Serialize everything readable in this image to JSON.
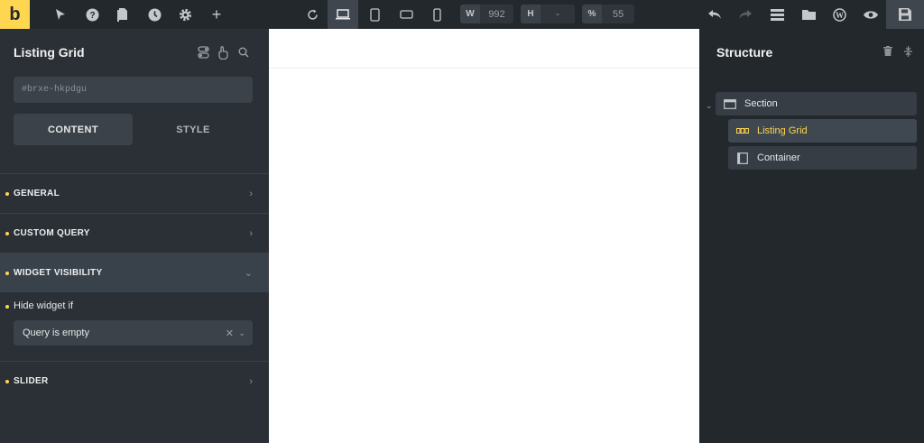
{
  "topbar": {
    "logo": "b",
    "width_label": "W",
    "width_value": "992",
    "height_label": "H",
    "height_value": "-",
    "zoom_label": "%",
    "zoom_value": "55"
  },
  "left_panel": {
    "title": "Listing Grid",
    "id_value": "#brxe-hkpdgu",
    "tabs": [
      {
        "label": "CONTENT",
        "active": true
      },
      {
        "label": "STYLE",
        "active": false
      }
    ],
    "sections": [
      {
        "label": "GENERAL"
      },
      {
        "label": "CUSTOM QUERY"
      },
      {
        "label": "WIDGET VISIBILITY",
        "open": true
      },
      {
        "label": "SLIDER"
      }
    ],
    "visibility": {
      "field_label": "Hide widget if",
      "select_value": "Query is empty"
    }
  },
  "structure_panel": {
    "title": "Structure",
    "items": [
      {
        "label": "Section",
        "icon": "section-icon"
      },
      {
        "label": "Listing Grid",
        "icon": "listing-grid-icon",
        "selected": true
      },
      {
        "label": "Container",
        "icon": "container-icon"
      }
    ]
  },
  "colors": {
    "accent": "#ffd64f",
    "panel_bg": "#2b3036",
    "topbar_bg": "#23282d",
    "canvas_bg": "#ffffff"
  }
}
